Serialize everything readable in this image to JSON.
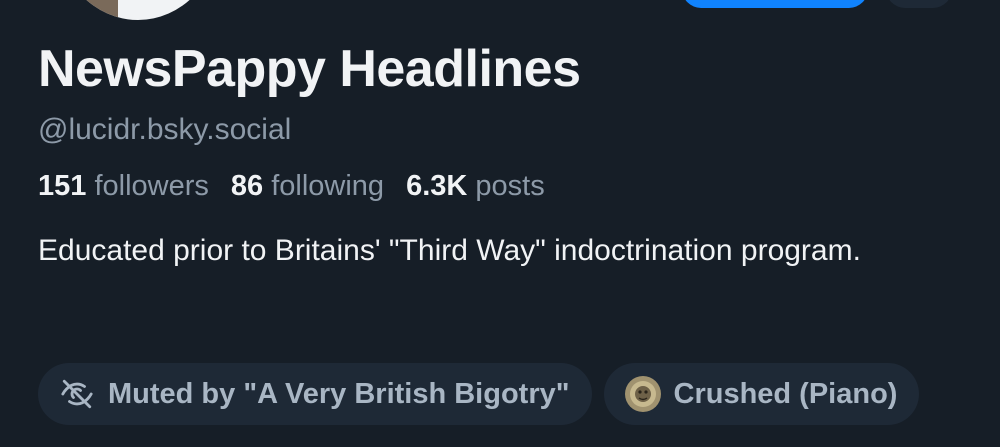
{
  "profile": {
    "display_name": "NewsPappy Headlines",
    "handle": "@lucidr.bsky.social",
    "stats": {
      "followers_count": "151",
      "followers_label": "followers",
      "following_count": "86",
      "following_label": "following",
      "posts_count": "6.3K",
      "posts_label": "posts"
    },
    "bio": "Educated prior to Britains' \"Third Way\" indoctrination program."
  },
  "labels": [
    {
      "text": "Muted by \"A Very British Bigotry\"",
      "icon": "eye-slash-icon"
    },
    {
      "text": "Crushed (Piano)",
      "icon": "labeler-avatar-icon"
    }
  ],
  "colors": {
    "background": "#161e27",
    "primary_text": "#f1f3f5",
    "secondary_text": "#8d9aa8",
    "chip_background": "#1e2936",
    "chip_text": "#a9b6c4",
    "accent": "#1083fe"
  }
}
